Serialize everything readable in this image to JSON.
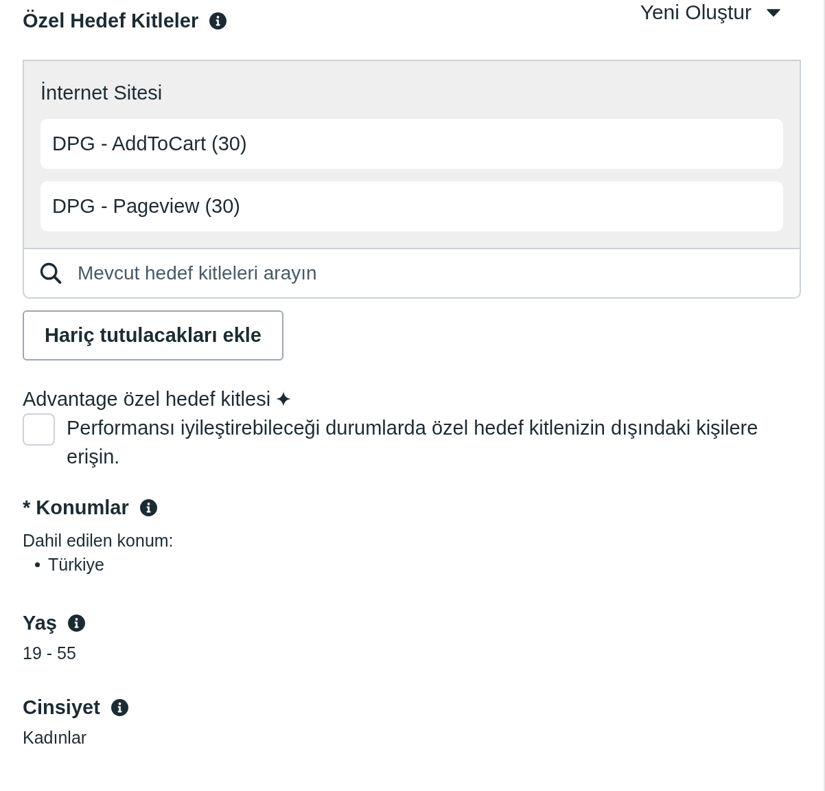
{
  "header": {
    "title": "Özel Hedef Kitleler",
    "create_menu": {
      "label": "Yeni Oluştur"
    }
  },
  "audience_box": {
    "section_title": "İnternet Sitesi",
    "items": [
      "DPG - AddToCart (30)",
      "DPG - Pageview (30)"
    ],
    "search": {
      "placeholder": "Mevcut hedef kitleleri arayın"
    }
  },
  "exclude_button": {
    "label": "Hariç tutulacakları ekle"
  },
  "advantage": {
    "title": "Advantage özel hedef kitlesi",
    "checkbox": {
      "label": "Performansı iyileştirebileceği durumlarda özel hedef kitlenizin dışındaki kişilere erişin.",
      "checked": false
    }
  },
  "sections": [
    {
      "kind": "list",
      "title": "* Konumlar",
      "subtitle": "Dahil edilen konum:",
      "items": [
        "Türkiye"
      ]
    },
    {
      "kind": "value",
      "title": "Yaş",
      "value": "19 - 55"
    },
    {
      "kind": "value",
      "title": "Cinsiyet",
      "value": "Kadınlar"
    }
  ]
}
